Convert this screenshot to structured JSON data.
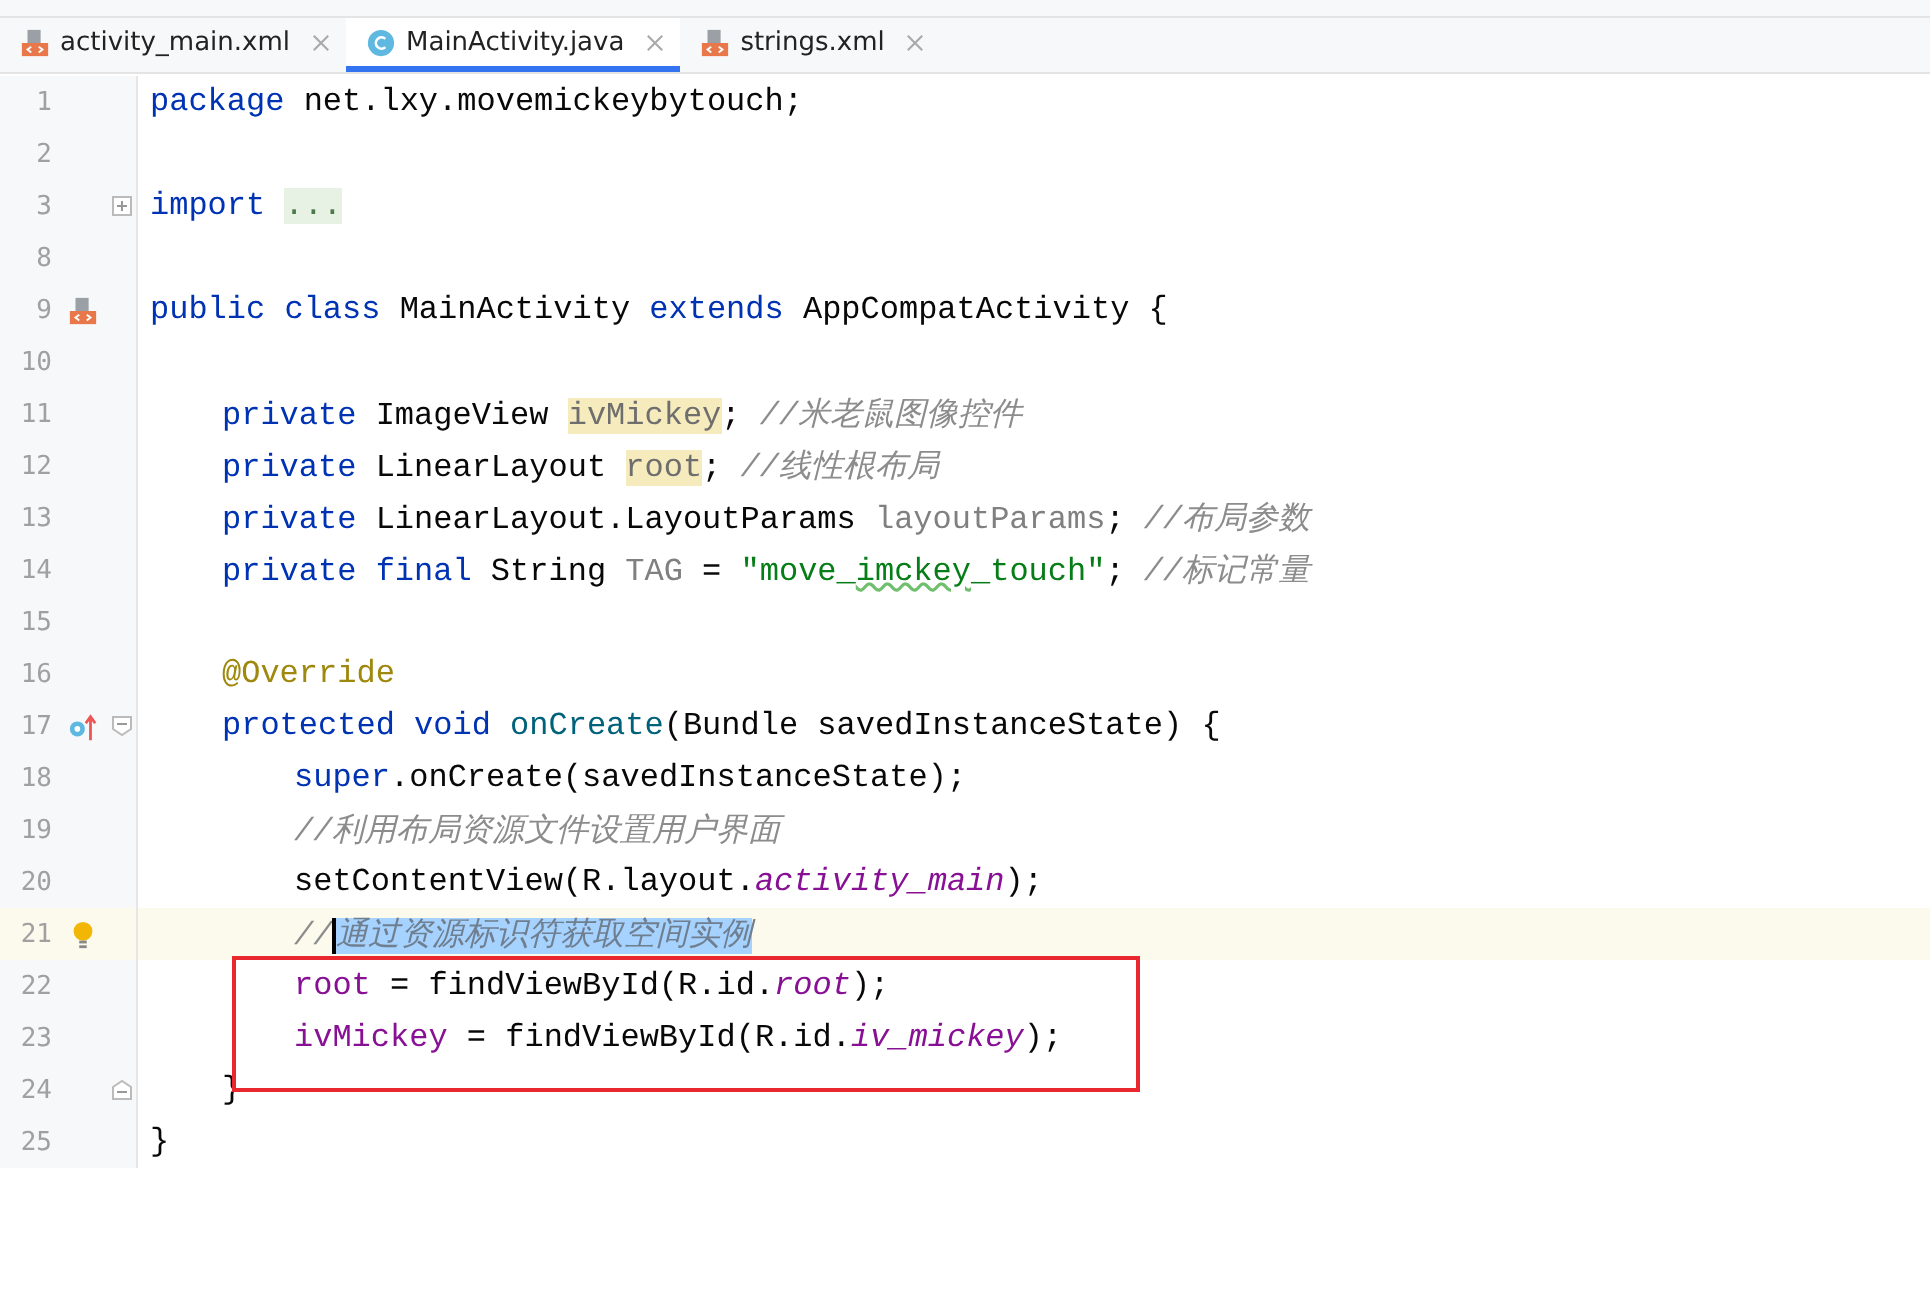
{
  "tabs": [
    {
      "label": "activity_main.xml",
      "kind": "xml",
      "selected": false
    },
    {
      "label": "MainActivity.java",
      "kind": "class",
      "selected": true
    },
    {
      "label": "strings.xml",
      "kind": "xml",
      "selected": false
    }
  ],
  "editor": {
    "lines": [
      {
        "number": "1",
        "current": false,
        "boxed": false,
        "tokens": [
          {
            "text": "package",
            "kind": "kw"
          },
          {
            "text": " net.lxy.movemickeybytouch;",
            "kind": "plain"
          }
        ]
      },
      {
        "number": "2",
        "current": false,
        "boxed": false
      },
      {
        "number": "3",
        "current": false,
        "boxed": false,
        "gutter": [
          {
            "kind": "fold-collapsed"
          }
        ],
        "tokens": [
          {
            "text": "import ",
            "kind": "kw"
          },
          {
            "text": "...",
            "kind": "folded"
          }
        ]
      },
      {
        "number": "8",
        "current": false,
        "boxed": false
      },
      {
        "number": "9",
        "current": false,
        "boxed": false,
        "gutter": [
          {
            "kind": "layout-link"
          }
        ],
        "tokens": [
          {
            "text": "public class",
            "kind": "kw"
          },
          {
            "text": " MainActivity ",
            "kind": "plain"
          },
          {
            "text": "extends",
            "kind": "kw"
          },
          {
            "text": " AppCompatActivity {",
            "kind": "plain"
          }
        ],
        "children": [
          {
            "number": "10",
            "current": false,
            "boxed": false
          },
          {
            "number": "11",
            "current": false,
            "boxed": false,
            "tokens": [
              {
                "text": "private",
                "kind": "kw"
              },
              {
                "text": " ImageView ",
                "kind": "plain"
              },
              {
                "text": "ivMickey",
                "kind": "usage"
              },
              {
                "text": "; ",
                "kind": "plain"
              },
              {
                "text": "//米老鼠图像控件",
                "kind": "comment"
              }
            ]
          },
          {
            "number": "12",
            "current": false,
            "boxed": false,
            "tokens": [
              {
                "text": "private",
                "kind": "kw"
              },
              {
                "text": " LinearLayout ",
                "kind": "plain"
              },
              {
                "text": "root",
                "kind": "usage"
              },
              {
                "text": "; ",
                "kind": "plain"
              },
              {
                "text": "//线性根布局",
                "kind": "comment"
              }
            ]
          },
          {
            "number": "13",
            "current": false,
            "boxed": false,
            "tokens": [
              {
                "text": "private",
                "kind": "kw"
              },
              {
                "text": " LinearLayout.LayoutParams ",
                "kind": "plain"
              },
              {
                "text": "layoutParams",
                "kind": "unused"
              },
              {
                "text": "; ",
                "kind": "plain"
              },
              {
                "text": "//布局参数",
                "kind": "comment"
              }
            ]
          },
          {
            "number": "14",
            "current": false,
            "boxed": false,
            "tokens": [
              {
                "text": "private final",
                "kind": "kw"
              },
              {
                "text": " String ",
                "kind": "plain"
              },
              {
                "text": "TAG",
                "kind": "unused"
              },
              {
                "text": " = ",
                "kind": "plain"
              },
              {
                "text": "\"move_",
                "kind": "string"
              },
              {
                "text": "imckey",
                "kind": "typo"
              },
              {
                "text": "_touch\"",
                "kind": "string"
              },
              {
                "text": "; ",
                "kind": "plain"
              },
              {
                "text": "//标记常量",
                "kind": "comment"
              }
            ]
          },
          {
            "number": "15",
            "current": false,
            "boxed": false
          },
          {
            "number": "16",
            "current": false,
            "boxed": false,
            "tokens": [
              {
                "text": "@Override",
                "kind": "annotation"
              }
            ]
          },
          {
            "number": "17",
            "current": false,
            "boxed": false,
            "gutter": [
              {
                "kind": "override"
              },
              {
                "kind": "fold-start"
              }
            ],
            "tokens": [
              {
                "text": "protected void ",
                "kind": "kw"
              },
              {
                "text": "onCreate",
                "kind": "method"
              },
              {
                "text": "(Bundle savedInstanceState) {",
                "kind": "plain"
              }
            ],
            "children": [
              {
                "number": "18",
                "current": false,
                "boxed": false,
                "tokens": [
                  {
                    "text": "super",
                    "kind": "kw"
                  },
                  {
                    "text": ".onCreate(savedInstanceState);",
                    "kind": "plain"
                  }
                ]
              },
              {
                "number": "19",
                "current": false,
                "boxed": false,
                "tokens": [
                  {
                    "text": "//利用布局资源文件设置用户界面",
                    "kind": "comment"
                  }
                ]
              },
              {
                "number": "20",
                "current": false,
                "boxed": false,
                "tokens": [
                  {
                    "text": "setContentView(R.layout.",
                    "kind": "plain"
                  },
                  {
                    "text": "activity_main",
                    "kind": "static"
                  },
                  {
                    "text": ");",
                    "kind": "plain"
                  }
                ]
              },
              {
                "number": "21",
                "current": true,
                "boxed": false,
                "gutter": [
                  {
                    "kind": "bulb"
                  }
                ],
                "tokens": [
                  {
                    "text": "//",
                    "kind": "comment"
                  },
                  {
                    "text": "通过资源标识符获取空间实例",
                    "kind": "selected-comment"
                  }
                ]
              },
              {
                "number": "22",
                "current": false,
                "boxed": true,
                "tokens": [
                  {
                    "text": "root",
                    "kind": "field"
                  },
                  {
                    "text": " = findViewById(R.id.",
                    "kind": "plain"
                  },
                  {
                    "text": "root",
                    "kind": "static"
                  },
                  {
                    "text": ");",
                    "kind": "plain"
                  }
                ]
              },
              {
                "number": "23",
                "current": false,
                "boxed": true,
                "tokens": [
                  {
                    "text": "ivMickey",
                    "kind": "field"
                  },
                  {
                    "text": " = findViewById(R.id.",
                    "kind": "plain"
                  },
                  {
                    "text": "iv_mickey",
                    "kind": "static"
                  },
                  {
                    "text": ");",
                    "kind": "plain"
                  }
                ]
              }
            ]
          },
          {
            "number": "24",
            "current": false,
            "boxed": false,
            "gutter": [
              {
                "kind": "fold-end"
              }
            ],
            "tokens": [
              {
                "text": "}",
                "kind": "plain"
              }
            ]
          }
        ]
      },
      {
        "number": "25",
        "current": false,
        "boxed": false,
        "tokens": [
          {
            "text": "}",
            "kind": "plain"
          }
        ]
      }
    ]
  }
}
